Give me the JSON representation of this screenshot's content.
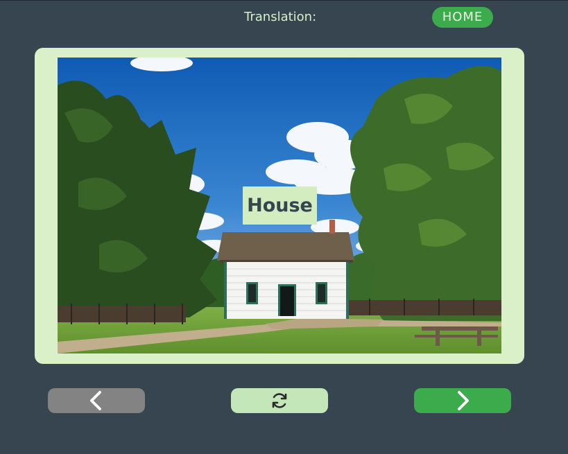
{
  "header": {
    "translation_label": "Translation:",
    "home_label": "HOME"
  },
  "card": {
    "word": "House",
    "image_subject": "white-house-under-blue-sky"
  },
  "controls": {
    "prev_icon": "chevron-left-icon",
    "refresh_icon": "refresh-icon",
    "next_icon": "chevron-right-icon"
  },
  "colors": {
    "background": "#36454f",
    "card": "#d9f0c8",
    "accent_green": "#3cab4b",
    "label_bg": "#d3edc1",
    "prev_button": "#838383",
    "refresh_button": "#c3e7b9",
    "text_light": "#d7f0c7"
  }
}
